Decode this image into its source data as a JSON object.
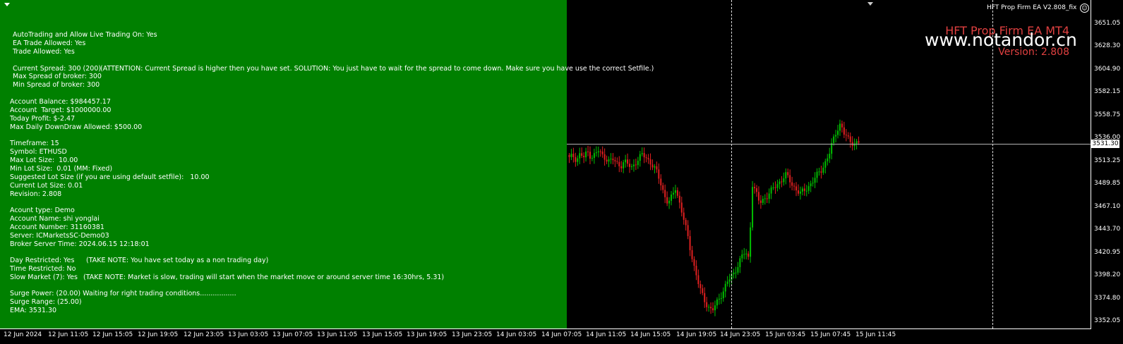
{
  "window": {
    "ea_label": "HFT Prop Firm EA V2.808_fix"
  },
  "overlay": {
    "ea_name": "HFT Prop Firm EA MT4",
    "watermark": "www.notandor.cn",
    "version": "Version:  2.808"
  },
  "info_panel": {
    "lines": [
      "AutoTrading and Allow Live Trading On: Yes",
      "EA Trade Allowed: Yes",
      "Trade Allowed: Yes",
      "Current Spread: 300 (200)",
      "(ATTENTION: Current Spread is higher then you have set. SOLUTION: You just have to wait for the spread to come down. Make sure you have use the correct Setfile.)",
      "Max Spread of broker: 300",
      "Min Spread of broker: 300",
      "Account Balance: $984457.17",
      "Account  Target: $1000000.00",
      "Today Profit: $-2.47",
      "Max Daily DownDraw Allowed: $500.00",
      "Timeframe: 15",
      "Symbol: ETHUSD",
      "Max Lot Size:  10.00",
      "Min Lot Size:  0.01 (MM: Fixed)",
      "Suggested Lot Size (if you are using default setfile):   10.00",
      "Current Lot Size: 0.01",
      "Revision: 2.808",
      "Acount type: Demo",
      "Account Name: shi yonglai",
      "Account Number: 31160381",
      "Server: ICMarketsSC-Demo03",
      "Broker Server Time: 2024.06.15 12:18:01",
      "Day Restricted: Yes",
      "(TAKE NOTE: You have set today as a non trading day)",
      "Time Restricted: No",
      "Slow Market (7): Yes",
      "(TAKE NOTE: Market is slow, trading will start when the market move or around server time 16:30hrs, 5.31)",
      "Surge Power: (20.00) Waiting for right trading conditions.................",
      "Surge Range: (25.00)",
      "EMA: 3531.30"
    ]
  },
  "price_axis": {
    "labels": [
      "3651.05",
      "3628.30",
      "3604.90",
      "3582.15",
      "3558.75",
      "3536.00",
      "3513.25",
      "3489.85",
      "3467.10",
      "3443.70",
      "3420.95",
      "3398.20",
      "3374.80",
      "3352.05"
    ],
    "current_price": "3531.30"
  },
  "time_axis": {
    "labels": [
      "12 Jun 2024",
      "12 Jun 11:05",
      "12 Jun 15:05",
      "12 Jun 19:05",
      "12 Jun 23:05",
      "13 Jun 03:05",
      "13 Jun 07:05",
      "13 Jun 11:05",
      "13 Jun 15:05",
      "13 Jun 19:05",
      "13 Jun 23:05",
      "14 Jun 03:05",
      "14 Jun 07:05",
      "14 Jun 11:05",
      "14 Jun 15:05",
      "14 Jun 19:05",
      "14 Jun 23:05",
      "15 Jun 03:45",
      "15 Jun 07:45",
      "15 Jun 11:45"
    ]
  },
  "chart_data": {
    "type": "candlestick",
    "symbol": "ETHUSD",
    "timeframe": "15",
    "ylim": [
      3352.05,
      3651.05
    ],
    "current_price": 3531.3,
    "ema": 3531.3,
    "close_path": [
      3515,
      3518,
      3514,
      3520,
      3516,
      3522,
      3517,
      3519,
      3523,
      3518,
      3516,
      3512,
      3514,
      3510,
      3508,
      3512,
      3509,
      3506,
      3511,
      3515,
      3519,
      3516,
      3512,
      3507,
      3500,
      3490,
      3478,
      3470,
      3476,
      3486,
      3472,
      3458,
      3442,
      3425,
      3408,
      3393,
      3380,
      3372,
      3366,
      3362,
      3368,
      3375,
      3382,
      3390,
      3395,
      3400,
      3408,
      3416,
      3421,
      3414,
      3490,
      3480,
      3470,
      3474,
      3478,
      3482,
      3486,
      3490,
      3494,
      3499,
      3494,
      3488,
      3484,
      3480,
      3482,
      3486,
      3490,
      3495,
      3500,
      3505,
      3512,
      3520,
      3533,
      3544,
      3550,
      3540,
      3535,
      3532,
      3530,
      3531
    ]
  },
  "colors": {
    "panel_bg": "#008000",
    "chart_bg": "#000000",
    "bull_candle": "#00c000",
    "bear_candle": "#e02020",
    "ea_name_color": "#e04040"
  },
  "icons": {
    "menu": "triangle-down-icon",
    "smile": "smiley-icon"
  }
}
